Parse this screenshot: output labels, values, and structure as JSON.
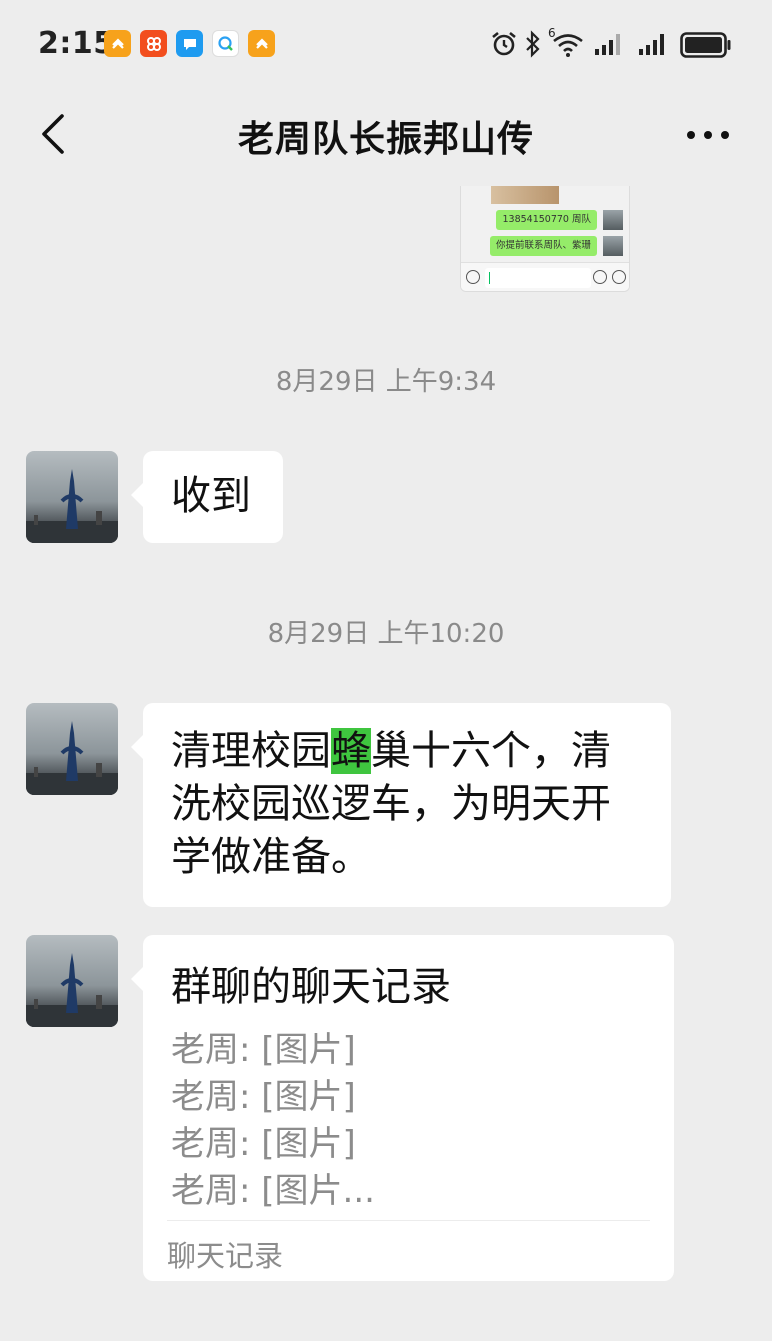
{
  "status_bar": {
    "time": "2:15",
    "app_icons": [
      {
        "name": "orange-app-icon",
        "color": "#f7a21b"
      },
      {
        "name": "shopping-app-icon",
        "color": "#f24e1e"
      },
      {
        "name": "message-app-icon",
        "color": "#1e9bf0"
      },
      {
        "name": "qq-browser-icon",
        "color": "#2aa1f3"
      },
      {
        "name": "orange-app-icon-2",
        "color": "#f7a21b"
      }
    ],
    "signal_label": "6"
  },
  "header": {
    "title": "老周队长振邦山传"
  },
  "shared_image": {
    "bubble1": "13854150770 周队",
    "bubble2": "你提前联系周队、紫珊"
  },
  "messages": [
    {
      "timestamp": "8月29日 上午9:34",
      "text": "收到"
    },
    {
      "timestamp": "8月29日 上午10:20",
      "line1_before": "清理校园",
      "line1_highlight": "蜂",
      "line1_after": "巢十六个，清",
      "line2": "洗校园巡逻车，为明天开",
      "line3": "学做准备。"
    }
  ],
  "chat_record": {
    "title": "群聊的聊天记录",
    "lines": [
      "老周: [图片]",
      "老周: [图片]",
      "老周: [图片]",
      "老周: [图片..."
    ],
    "footer": "聊天记录"
  },
  "colors": {
    "background": "#ededed",
    "bubble": "#ffffff",
    "highlight": "#3fc53f",
    "sent_bubble": "#95ec69"
  }
}
